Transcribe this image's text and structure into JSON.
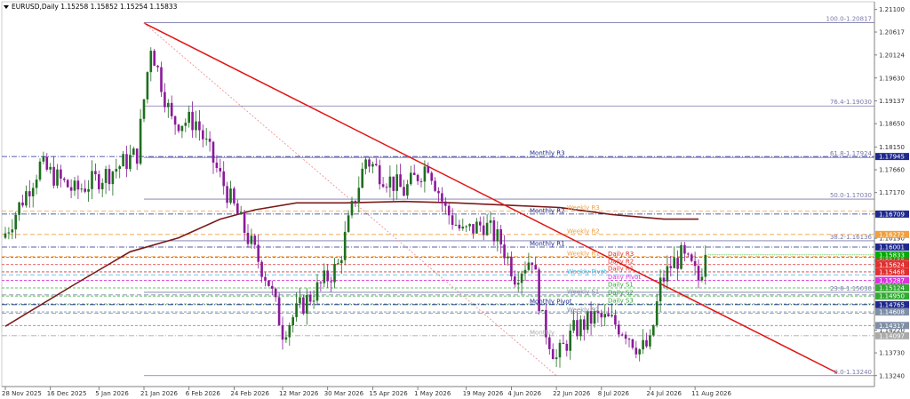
{
  "symbol_info": "EURUSD,Daily  1.15258 1.15852 1.15254 1.15833",
  "colors": {
    "bull": "#1f6e1f",
    "bear": "#8a1a99",
    "trendline": "#e01515",
    "ma": "#7a1a1a",
    "fib": "#7777aa",
    "monthly": "#1f2a8f",
    "weekly": "#f0a040",
    "daily_res": "#e03030",
    "daily_sup": "#33aa33",
    "daily_pivot": "#dd33dd",
    "weekly_sup": "#7f8fa6",
    "current": "#00aa00"
  },
  "chart_data": {
    "type": "candlestick",
    "title": "EURUSD,Daily",
    "ohlc_header": {
      "open": 1.15258,
      "high": 1.15852,
      "low": 1.15254,
      "close": 1.15833
    },
    "ylim": [
      1.1314,
      1.2119
    ],
    "price_ticks": [
      1.211,
      1.20617,
      1.20124,
      1.1963,
      1.19137,
      1.1865,
      1.1815,
      1.1766,
      1.1717,
      1.16709,
      1.1619,
      1.157,
      1.1522,
      1.1422,
      1.1373,
      1.1324
    ],
    "x_tick_labels": [
      "28 Nov 2025",
      "16 Dec 2025",
      "5 Jan 2026",
      "21 Jan 2026",
      "6 Feb 2026",
      "24 Feb 2026",
      "12 Mar 2026",
      "30 Mar 2026",
      "15 Apr 2026",
      "1 May 2026",
      "19 May 2026",
      "4 Jun 2026",
      "22 Jun 2026",
      "8 Jul 2026",
      "24 Jul 2026",
      "11 Aug 2026"
    ],
    "x_tick_index": [
      0,
      13,
      27,
      40,
      53,
      66,
      80,
      93,
      106,
      119,
      133,
      146,
      159,
      172,
      186,
      199
    ],
    "anchors": [
      [
        0,
        1.163
      ],
      [
        10,
        1.1775
      ],
      [
        20,
        1.172
      ],
      [
        30,
        1.176
      ],
      [
        38,
        1.18
      ],
      [
        42,
        1.2035
      ],
      [
        48,
        1.187
      ],
      [
        55,
        1.187
      ],
      [
        62,
        1.175
      ],
      [
        70,
        1.162
      ],
      [
        76,
        1.1525
      ],
      [
        80,
        1.142
      ],
      [
        85,
        1.147
      ],
      [
        90,
        1.151
      ],
      [
        96,
        1.156
      ],
      [
        100,
        1.168
      ],
      [
        104,
        1.179
      ],
      [
        108,
        1.176
      ],
      [
        115,
        1.172
      ],
      [
        122,
        1.178
      ],
      [
        127,
        1.168
      ],
      [
        132,
        1.163
      ],
      [
        138,
        1.165
      ],
      [
        143,
        1.161
      ],
      [
        147,
        1.154
      ],
      [
        152,
        1.158
      ],
      [
        155,
        1.144
      ],
      [
        159,
        1.136
      ],
      [
        164,
        1.142
      ],
      [
        170,
        1.145
      ],
      [
        175,
        1.144
      ],
      [
        179,
        1.142
      ],
      [
        183,
        1.138
      ],
      [
        186,
        1.139
      ],
      [
        189,
        1.152
      ],
      [
        192,
        1.156
      ],
      [
        195,
        1.158
      ],
      [
        198,
        1.1555
      ],
      [
        200,
        1.153
      ],
      [
        202,
        1.1583
      ]
    ],
    "fib_levels": [
      {
        "label": "100.0-1.20817",
        "price": 1.20817
      },
      {
        "label": "76.4-1.19030",
        "price": 1.1903
      },
      {
        "label": "61.8-1.17924",
        "price": 1.17924
      },
      {
        "label": "50.0-1.17030",
        "price": 1.1703
      },
      {
        "label": "38.2-1.16136",
        "price": 1.16136
      },
      {
        "label": "23.6-1.15030",
        "price": 1.1503
      },
      {
        "label": "0.0-1.13240",
        "price": 1.1324
      }
    ],
    "pivot_levels": [
      {
        "label": "Monthly R3",
        "price": 1.17945,
        "tag": "1.17945",
        "color": "#1f2a8f",
        "text": "#1f2a8f"
      },
      {
        "label": "Monthly R2",
        "price": 1.16709,
        "tag": "1.16709",
        "color": "#1f2a8f",
        "text": "#1f2a8f"
      },
      {
        "label": "Weekly R3",
        "price": 1.16772,
        "tag": "",
        "color": "#f0a040",
        "text": "#f0a040"
      },
      {
        "label": "Weekly R2",
        "price": 1.16272,
        "tag": "1.16272",
        "color": "#f0a040",
        "text": "#f0a040"
      },
      {
        "label": "Monthly R1",
        "price": 1.16001,
        "tag": "1.16001",
        "color": "#1f2a8f",
        "text": "#1f2a8f"
      },
      {
        "label": "Weekly R1",
        "price": 1.15795,
        "tag": "",
        "color": "#f0a040",
        "text": "#f0a040"
      },
      {
        "label": "Daily R3",
        "price": 1.1578,
        "tag": "1.15795",
        "color": "#e03030",
        "text": "#e03030"
      },
      {
        "label": "Daily R2",
        "price": 1.15624,
        "tag": "1.15624",
        "color": "#e03030",
        "text": "#e03030"
      },
      {
        "label": "Daily R1",
        "price": 1.15468,
        "tag": "1.15468",
        "color": "#e03030",
        "text": "#e03030"
      },
      {
        "label": "Weekly Pivot",
        "price": 1.15405,
        "tag": "",
        "color": "#33bbee",
        "text": "#33bbee"
      },
      {
        "label": "Daily Pivot",
        "price": 1.15287,
        "tag": "1.15287",
        "color": "#dd33dd",
        "text": "#dd33dd"
      },
      {
        "label": "Daily S1",
        "price": 1.15124,
        "tag": "1.15124",
        "color": "#33aa33",
        "text": "#33aa33"
      },
      {
        "label": "Weekly S1",
        "price": 1.14975,
        "tag": "",
        "color": "#7f8fa6",
        "text": "#7f8fa6"
      },
      {
        "label": "Daily S2",
        "price": 1.1495,
        "tag": "1.14950",
        "color": "#33aa33",
        "text": "#33aa33"
      },
      {
        "label": "Daily S3",
        "price": 1.1478,
        "tag": "",
        "color": "#33aa33",
        "text": "#33aa33"
      },
      {
        "label": "Monthly Pivot",
        "price": 1.14765,
        "tag": "1.14765",
        "color": "#1f2a8f",
        "text": "#1f2a8f"
      },
      {
        "label": "",
        "price": 1.14608,
        "tag": "1.14608",
        "color": "#7f8fa6",
        "text": "#7f8fa6"
      },
      {
        "label": "Weekly S2",
        "price": 1.1458,
        "tag": "",
        "color": "#7f8fa6",
        "text": "#7f8fa6"
      },
      {
        "label": "",
        "price": 1.14317,
        "tag": "1.14317",
        "color": "#7f8fa6",
        "text": "#7f8fa6"
      },
      {
        "label": "Monthly",
        "price": 1.14097,
        "tag": "1.14097",
        "color": "#aaaaaa",
        "text": "#aaaaaa"
      }
    ],
    "current_price": {
      "label": "1.15833",
      "price": 1.15833
    },
    "trendline": {
      "from": [
        40,
        1.2081
      ],
      "to": [
        240,
        1.133
      ]
    },
    "dotted_line": {
      "from": [
        40,
        1.2081
      ],
      "to": [
        159,
        1.1324
      ]
    },
    "moving_average": [
      [
        0,
        1.143
      ],
      [
        20,
        1.152
      ],
      [
        36,
        1.159
      ],
      [
        50,
        1.162
      ],
      [
        62,
        1.166
      ],
      [
        72,
        1.168
      ],
      [
        84,
        1.1695
      ],
      [
        98,
        1.1695
      ],
      [
        115,
        1.1698
      ],
      [
        130,
        1.1695
      ],
      [
        145,
        1.169
      ],
      [
        160,
        1.1685
      ],
      [
        175,
        1.167
      ],
      [
        190,
        1.166
      ],
      [
        200,
        1.166
      ]
    ]
  }
}
